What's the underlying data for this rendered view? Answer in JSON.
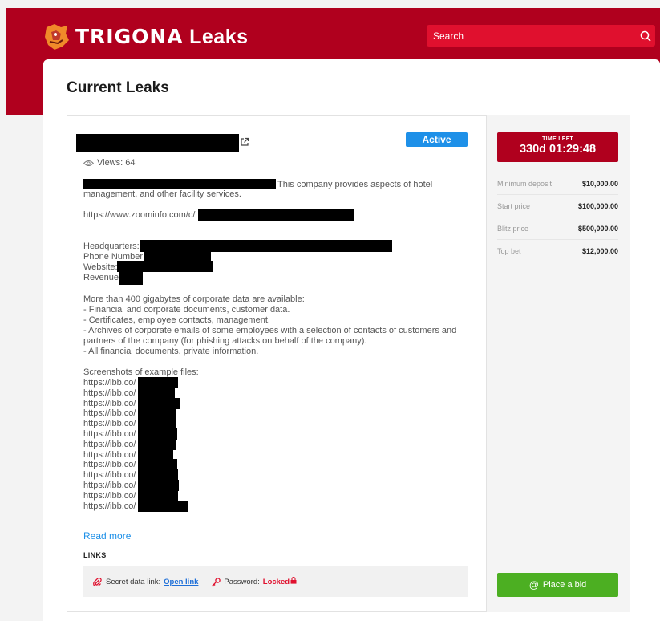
{
  "header": {
    "logo_brand": "TRIGONA",
    "logo_suffix": "Leaks",
    "search_placeholder": "Search"
  },
  "page_title": "Current Leaks",
  "leak": {
    "status": "Active",
    "views": "Views: 64",
    "description_tail": "This company provides aspects of hotel",
    "description_line2": "management, and other facility services.",
    "zoominfo_prefix": "https://www.zoominfo.com/c/",
    "headquarters_label": "Headquarters:",
    "phone_label": "Phone Number:",
    "website_label": "Website:",
    "revenue_label": "Revenue:",
    "data_lines": [
      "More than 400 gigabytes of corporate data are available:",
      "- Financial and corporate documents, customer data.",
      "- Certificates, employee contacts, management.",
      "- Archives of corporate emails of some employees with a selection of contacts of customers and",
      "partners of the company (for phishing attacks on behalf of the company).",
      "- All financial documents, private information."
    ],
    "screenshots_heading": "Screenshots of example files:",
    "ibb_prefix": "https://ibb.co/",
    "ibb_count": 13,
    "read_more": "Read more",
    "read_more_arrow": "→",
    "links_heading": "LINKS",
    "secret_link_label": "Secret data link:",
    "open_link": "Open link",
    "password_label": "Password:",
    "password_status": "Locked"
  },
  "sidebar": {
    "time_left_label": "TIME LEFT",
    "time_left_value": "330d 01:29:48",
    "stats": [
      {
        "label": "Minimum deposit",
        "value": "$10,000.00"
      },
      {
        "label": "Start price",
        "value": "$100,000.00"
      },
      {
        "label": "Blitz price",
        "value": "$500,000.00"
      },
      {
        "label": "Top bet",
        "value": "$12,000.00"
      }
    ],
    "bid_button": "Place a bid",
    "bid_icon": "at-icon"
  },
  "colors": {
    "brand_red": "#b0001e",
    "search_red": "#e0102e",
    "active_blue": "#1e90e8",
    "bid_green": "#4caf22"
  }
}
